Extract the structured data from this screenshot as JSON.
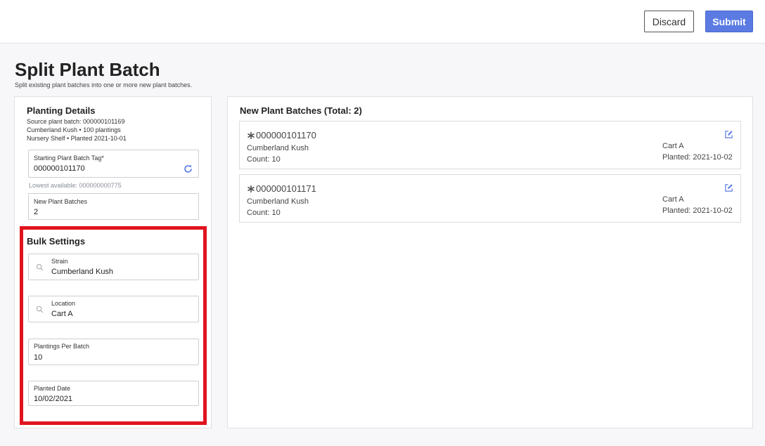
{
  "header": {
    "discard_label": "Discard",
    "submit_label": "Submit"
  },
  "page": {
    "title": "Split Plant Batch",
    "subtitle": "Split existing plant batches into one or more new plant batches."
  },
  "planting_details": {
    "title": "Planting Details",
    "source": "Source plant batch: 000000101169",
    "strain_line": "Cumberland Kush • 100 plantings",
    "location_line": "Nursery Shelf • Planted 2021-10-01",
    "starting_tag": {
      "label": "Starting Plant Batch Tag*",
      "value": "000000101170",
      "hint": "Lowest available: 000000000775"
    },
    "new_batches": {
      "label": "New Plant Batches",
      "value": "2"
    }
  },
  "bulk_settings": {
    "title": "Bulk Settings",
    "strain": {
      "label": "Strain",
      "value": "Cumberland Kush"
    },
    "location": {
      "label": "Location",
      "value": "Cart A"
    },
    "plantings_per_batch": {
      "label": "Plantings Per Batch",
      "value": "10"
    },
    "planted_date": {
      "label": "Planted Date",
      "value": "10/02/2021"
    },
    "highlight_color": "#e0141e"
  },
  "new_batches": {
    "title": "New Plant Batches (Total: 2)",
    "items": [
      {
        "tag": "000000101170",
        "strain": "Cumberland Kush",
        "count": "Count: 10",
        "location": "Cart A",
        "planted": "Planted: 2021-10-02"
      },
      {
        "tag": "000000101171",
        "strain": "Cumberland Kush",
        "count": "Count: 10",
        "location": "Cart A",
        "planted": "Planted: 2021-10-02"
      }
    ]
  },
  "colors": {
    "accent": "#5b7be3",
    "icon": "#5b7be3"
  }
}
